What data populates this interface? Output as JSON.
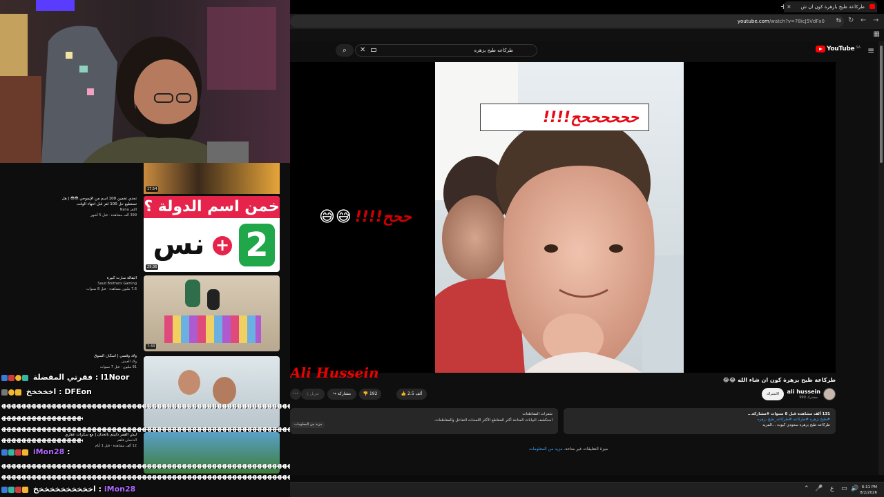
{
  "browser": {
    "tab_title": "طركاعة طيح بازهرة كون ان ش",
    "tab_close": "×",
    "new_tab": "+",
    "url_host": "youtube.com",
    "url_path": "/watch?v=78icJ5VdFx0",
    "nav_back": "←",
    "nav_forward": "→",
    "nav_reload": "↻",
    "tune_icon": "⇆",
    "ext_icon": "▦"
  },
  "youtube": {
    "logo_text": "YouTube",
    "country": "SA",
    "menu_glyph": "≡",
    "search_query": "طركاعه طيح بزهره",
    "search_clear": "✕",
    "search_glyph": "⌕",
    "video_captions": {
      "big": "ححححححح!!!!",
      "big_emoji": "😅😅😅",
      "side": "ححح!!!!",
      "side_emoji": "😅😅",
      "watermark": "Ali Hussein"
    },
    "video_title": "طركاعة طيح بزهرة كون ان شاء الله 😂😂",
    "channel": {
      "name": "ali hussein",
      "subs": "990 مشترك",
      "subscribe": "الاشتراك"
    },
    "actions": {
      "like_count": "2.5 ألف",
      "dislike_count": "192",
      "share": "مشاركة",
      "download": "تنزيل",
      "more": "⋯"
    },
    "description": {
      "stats": "131 ألف مشاهدة  قبل 8 سنوات  #مشاركة...",
      "tags": "#طيح بزهره #طركاعه #طركاعه_طيح بزهره",
      "line3": "طركاعه طيح بزهره سعودي كيوت ...المزيد"
    },
    "info_panel": {
      "title": "شفرات المقاطعات",
      "body": "استكشف البيانات المتاحة أكثر المقاطع الأكثر اللمحات التفاعل والمقاطعات.",
      "more": "مزيد من المعلومات"
    },
    "comments_note": {
      "prefix": "ميزة التعليقات غير متاحة.",
      "link": "مزيد من المعلومات"
    }
  },
  "taskbar": {
    "time": "6:11 PM",
    "date": "8/2/2026",
    "lang": "ع",
    "icons": {
      "chevron": "⌃",
      "mic": "🎤",
      "display": "▭",
      "volume": "🔊",
      "bell": "🔔",
      "battery": "▮"
    }
  },
  "overlay": {
    "rec_videos": [
      {
        "duration": "17:54",
        "title": "",
        "channel": "",
        "stats": ""
      },
      {
        "duration": "29:36",
        "title": "تحدي تخمين 100 اسم من الإيموجي 😳😳 | هل تستطيع حل 100 لغز قبل انتهاء الوقت",
        "channel": "اللغز Nana",
        "stats": "399 ألف مشاهدة · قبل 5 أشهر"
      },
      {
        "duration": "7:33",
        "title": "البقالة سارت كبيرة",
        "channel": "Saud Brothers Gaming",
        "stats": "7.6 مليون مشاهدة · قبل 8 سنوات"
      },
      {
        "duration": "",
        "title": "ولاد وقسي | اسكان السوق",
        "channel": "ولاد العيش",
        "stats": "91 مليون · قبل 7 سنوات"
      },
      {
        "duration": "",
        "title": "ليش القمر ذايبتم بالحدان | مع سكرات عقاري",
        "channel": "الدحمان فاهم",
        "stats": "12 ألف مشاهدة · قبل 1 أيام"
      }
    ],
    "thumb_text": {
      "guess": "خمن اسم الدولة ؟",
      "plus": "+",
      "two": "2",
      "word": "نس"
    },
    "chat": [
      {
        "user": "l1Noor",
        "message": "فقرتي المفضلة",
        "color": "#ffffff",
        "sep": " : "
      },
      {
        "user": "DFEon",
        "message": "اخخخخخ",
        "color": "#ffffff",
        "sep": " : "
      },
      {
        "user": "iMon28",
        "message": "",
        "color": "#b26bff",
        "sep": " :"
      },
      {
        "user": "iMon28",
        "message": "اخخخخخخخخخخخ",
        "color": "#b26bff",
        "sep": " : "
      }
    ],
    "spam_line": "ﻬﻬﻬﻬﻬﻬﻬﻬﻬﻬﻬﻬﻬﻬﻬﻬﻬﻬﻬﻬﻬﻬﻬﻬﻬﻬﻬﻬﻬﻬﻬﻬﻬﻬﻬﻬﻬﻬﻬﻬﻬﻬﻬﻬﻬﻬﻬﻬﻬﻬﻬﻬﻬﻬﻬﻬﻬﻬﻬﻬﻬﻬﻬ",
    "spam_short": "ﻬﻬﻬﻬﻬﻬﻬﻬﻬﻬﻬﻬﻬﻬﻬﻬﻬﻬﻬﻬﻬﻬﻬﻬﻬﻬﻬﻬﻬﻬﻬﻬ"
  },
  "colors": {
    "yt_red": "#ff0000",
    "link": "#3ea6ff",
    "caption_red": "#e50914",
    "chat_purple": "#b26bff"
  }
}
